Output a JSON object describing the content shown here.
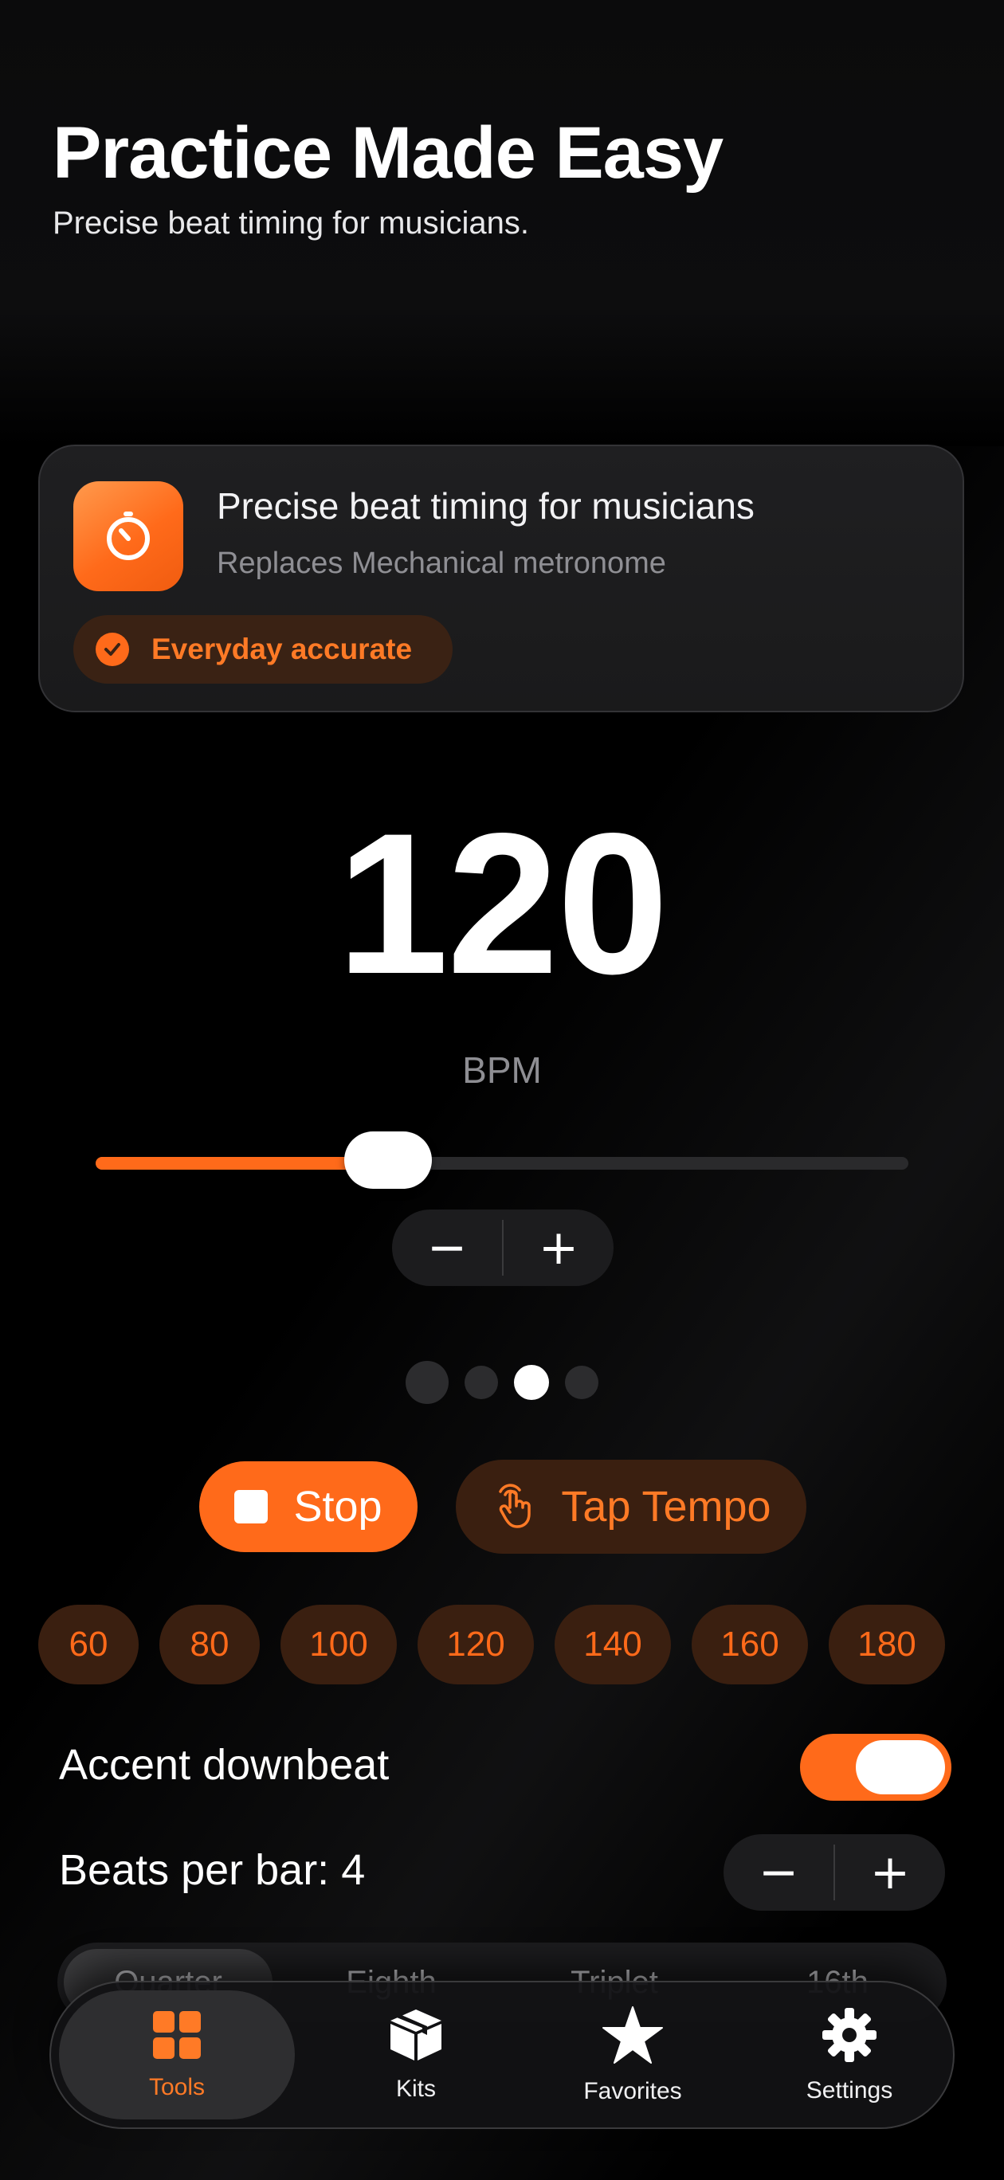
{
  "header": {
    "title": "Practice Made Easy",
    "subtitle": "Precise beat timing for musicians."
  },
  "info_card": {
    "icon": "stopwatch-icon",
    "title": "Precise beat timing for musicians",
    "subtitle": "Replaces Mechanical metronome",
    "chip_icon": "checkmark-circle-icon",
    "chip_label": "Everyday accurate"
  },
  "tempo": {
    "bpm": "120",
    "unit_label": "BPM",
    "slider_fraction": 0.36,
    "decrement_label": "−",
    "increment_label": "+"
  },
  "beats": {
    "count": 4,
    "active_index": 2
  },
  "controls": {
    "stop_label": "Stop",
    "stop_icon": "stop-square-icon",
    "tap_label": "Tap Tempo",
    "tap_icon": "hand-tap-icon"
  },
  "presets": [
    "60",
    "80",
    "100",
    "120",
    "140",
    "160",
    "180"
  ],
  "settings": {
    "accent_label": "Accent downbeat",
    "accent_on": true,
    "beats_per_bar_label": "Beats per bar: 4",
    "decrement_label": "−",
    "increment_label": "+"
  },
  "subdivisions": {
    "items": [
      "Quarter",
      "Eighth",
      "Triplet",
      "16th"
    ],
    "selected": "Quarter"
  },
  "tabbar": {
    "items": [
      {
        "label": "Tools",
        "icon": "grid-icon",
        "active": true
      },
      {
        "label": "Kits",
        "icon": "box-icon",
        "active": false
      },
      {
        "label": "Favorites",
        "icon": "star-icon",
        "active": false
      },
      {
        "label": "Settings",
        "icon": "gear-icon",
        "active": false
      }
    ]
  },
  "colors": {
    "accent": "#ff6a1a",
    "accent_dark": "#3a1f10",
    "background": "#000000",
    "card": "#1c1c1e"
  }
}
